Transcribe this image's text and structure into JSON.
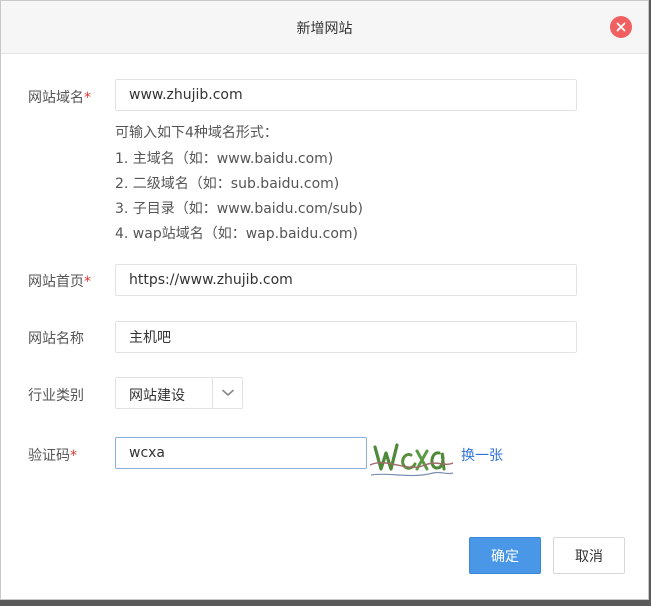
{
  "dialog": {
    "title": "新增网站"
  },
  "form": {
    "domain": {
      "label": "网站域名",
      "required_mark": "*",
      "value": "www.zhujib.com"
    },
    "domain_hints": {
      "intro": "可输入如下4种域名形式：",
      "items": [
        "1. 主域名（如：www.baidu.com)",
        "2. 二级域名（如：sub.baidu.com)",
        "3. 子目录（如：www.baidu.com/sub)",
        "4. wap站域名（如：wap.baidu.com)"
      ]
    },
    "homepage": {
      "label": "网站首页",
      "required_mark": "*",
      "value": "https://www.zhujib.com"
    },
    "site_name": {
      "label": "网站名称",
      "value": "主机吧"
    },
    "category": {
      "label": "行业类别",
      "selected": "网站建设"
    },
    "captcha": {
      "label": "验证码",
      "required_mark": "*",
      "value": "wcxa",
      "refresh_label": "换一张"
    }
  },
  "actions": {
    "confirm_label": "确定",
    "cancel_label": "取消"
  },
  "colors": {
    "primary": "#4a97e8",
    "link": "#2f73d8",
    "required": "#e23535",
    "close": "#f06060"
  },
  "icons": {
    "close": "close-icon",
    "dropdown": "chevron-down-icon"
  }
}
